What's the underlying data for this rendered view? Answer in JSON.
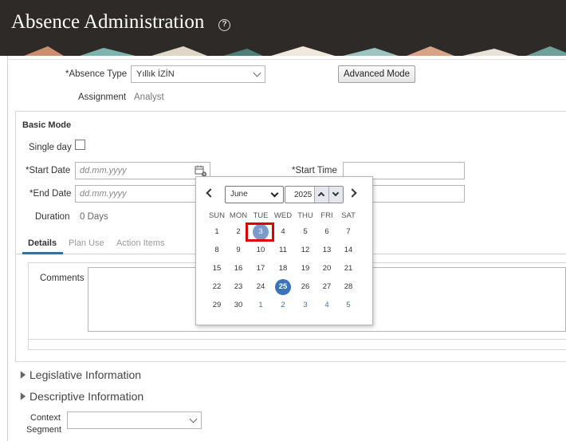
{
  "header": {
    "title": "Absence Administration",
    "help": "?"
  },
  "form": {
    "absence_type_label": "Absence Type",
    "absence_type_value": "Yıllık İZİN",
    "advanced_mode_label": "Advanced Mode",
    "assignment_label": "Assignment",
    "assignment_value": "Analyst",
    "required_marker": "*"
  },
  "basic": {
    "section_title": "Basic Mode",
    "single_day_label": "Single day",
    "start_date_label": "Start Date",
    "start_date_placeholder": "dd.mm.yyyy",
    "end_date_label": "End Date",
    "end_date_placeholder": "dd.mm.yyyy",
    "start_time_label": "Start Time",
    "duration_label": "Duration",
    "duration_value": "0 Days"
  },
  "tabs": [
    {
      "label": "Details",
      "active": true
    },
    {
      "label": "Plan Use",
      "active": false
    },
    {
      "label": "Action Items",
      "active": false
    }
  ],
  "details": {
    "comments_label": "Comments"
  },
  "calendar": {
    "month": "June",
    "year": "2025",
    "weekdays": [
      "SUN",
      "MON",
      "TUE",
      "WED",
      "THU",
      "FRI",
      "SAT"
    ],
    "weeks": [
      [
        "1",
        "2",
        "3",
        "4",
        "5",
        "6",
        "7"
      ],
      [
        "8",
        "9",
        "10",
        "11",
        "12",
        "13",
        "14"
      ],
      [
        "15",
        "16",
        "17",
        "18",
        "19",
        "20",
        "21"
      ],
      [
        "22",
        "23",
        "24",
        "25",
        "26",
        "27",
        "28"
      ],
      [
        "29",
        "30",
        "1",
        "2",
        "3",
        "4",
        "5"
      ]
    ],
    "selected_day": "3",
    "today": "25"
  },
  "sections": {
    "legislative": "Legislative Information",
    "descriptive": "Descriptive Information"
  },
  "context": {
    "label_line1": "Context",
    "label_line2": "Segment"
  },
  "colors": {
    "header_bg": "#2d2a28",
    "accent": "#3c6e9c",
    "today": "#3a73b8",
    "selected": "#7a9ccc",
    "highlight_border": "#e00000"
  }
}
